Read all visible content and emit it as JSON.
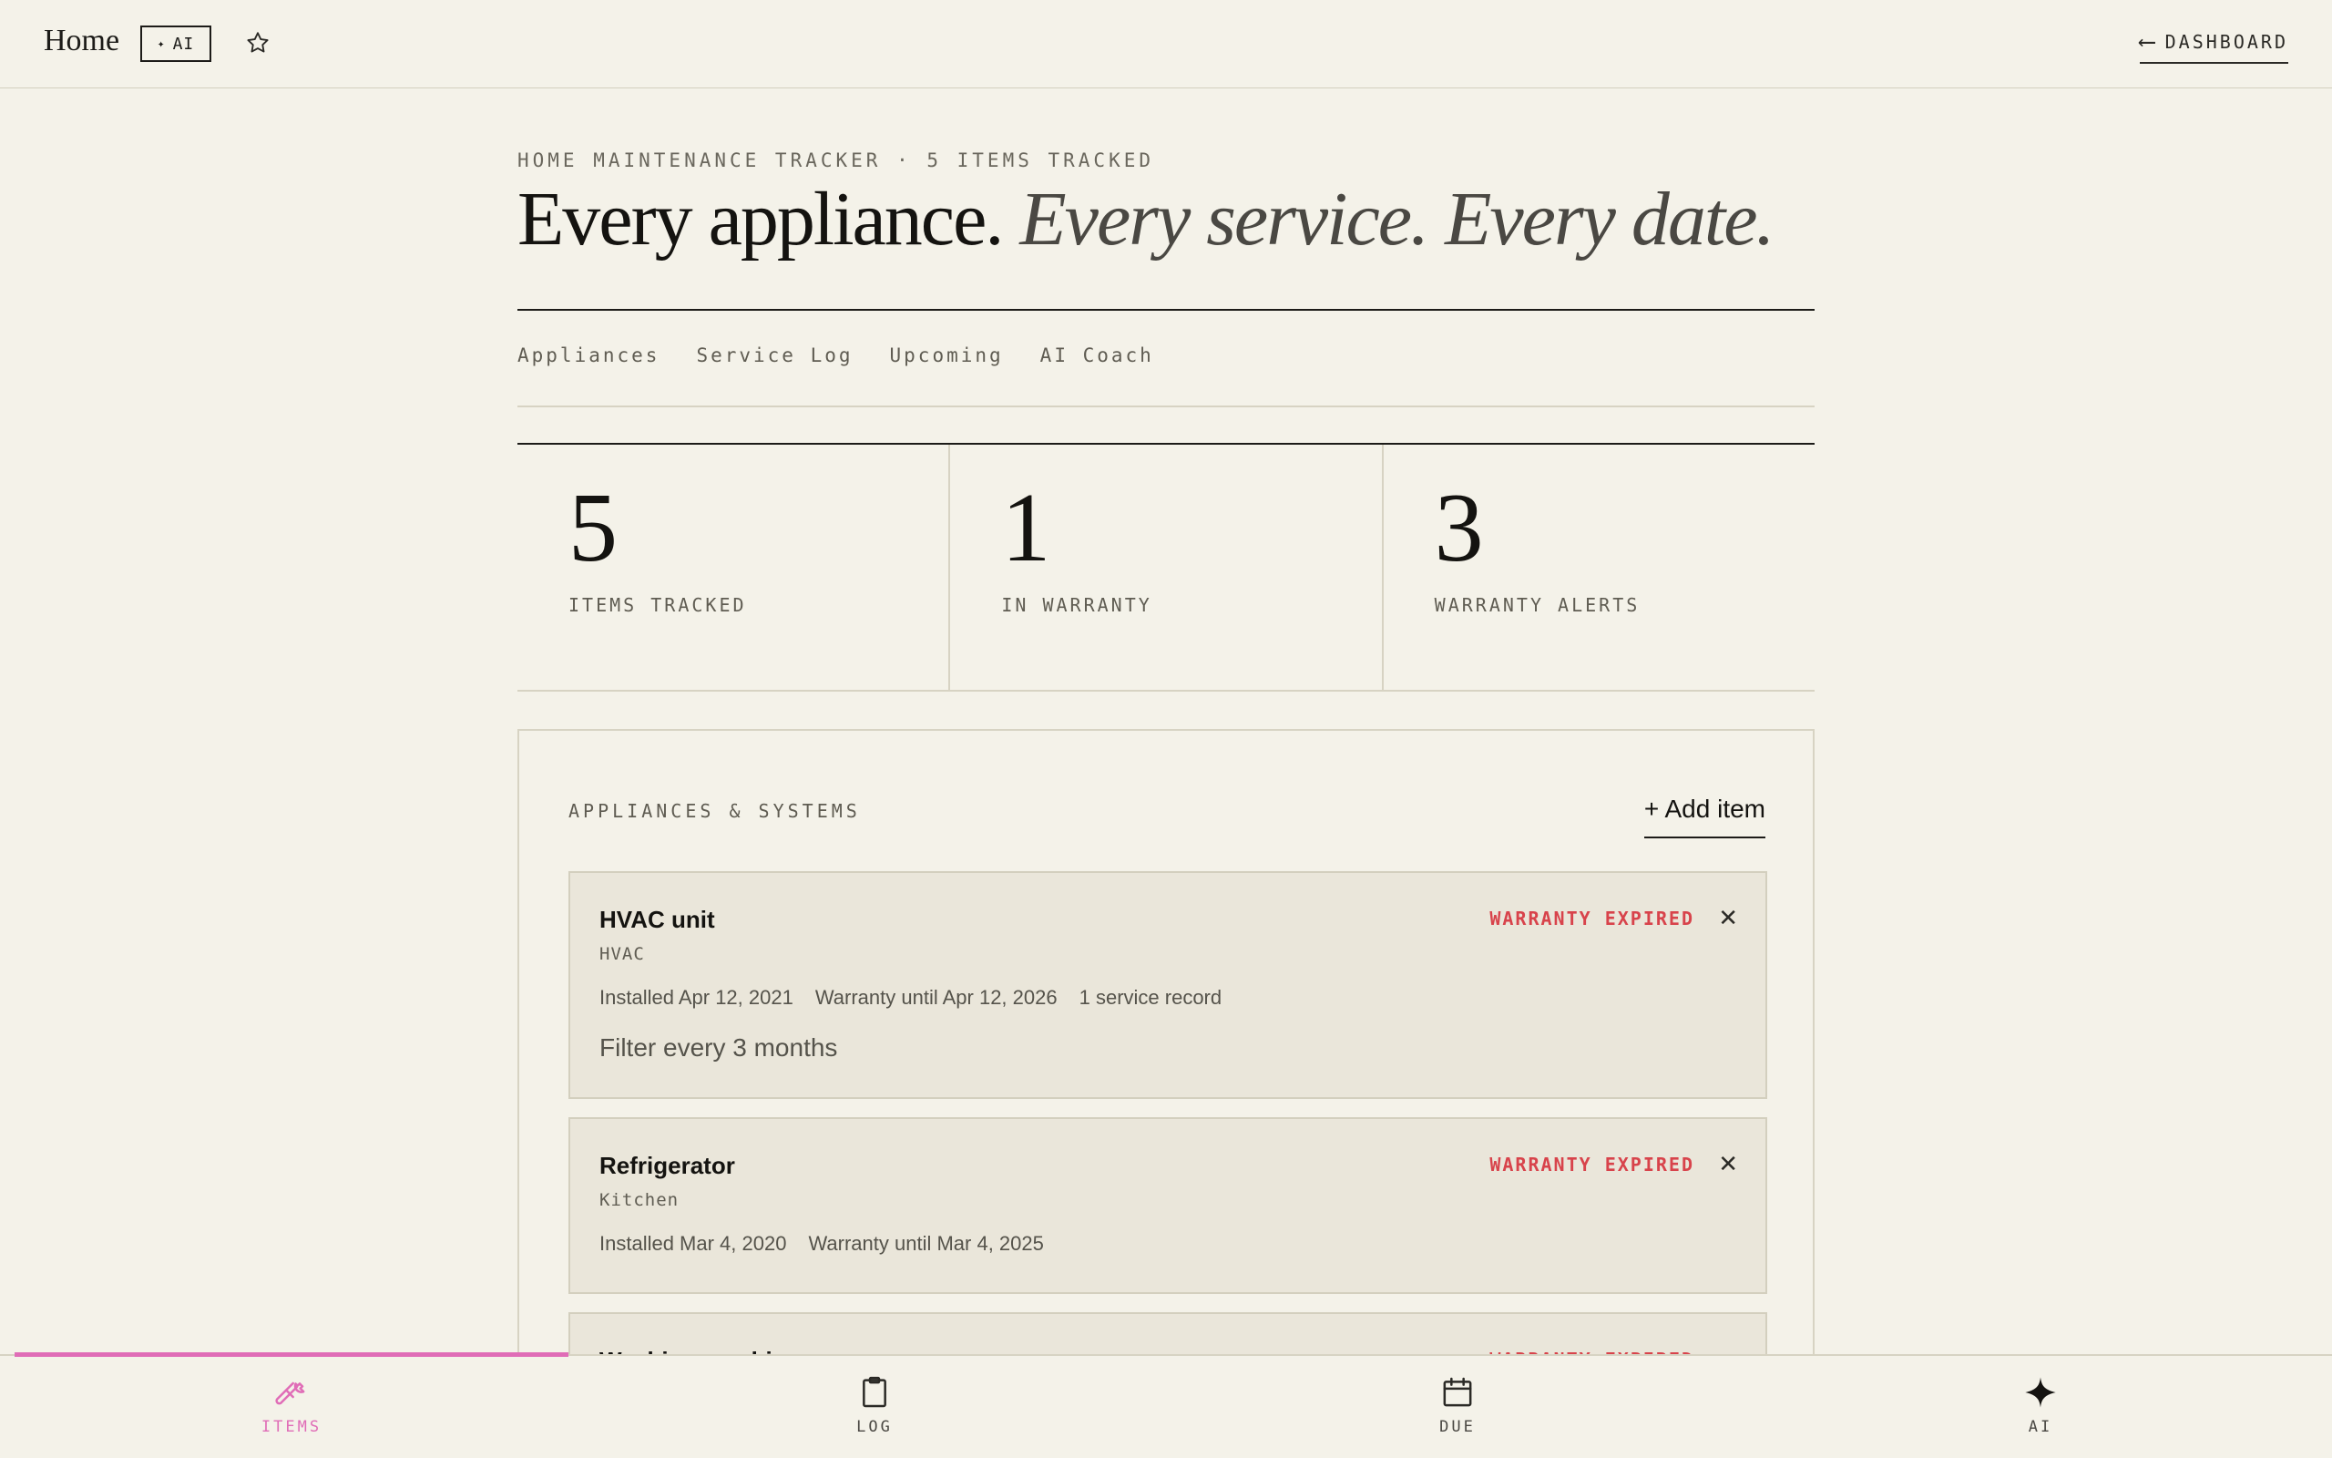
{
  "app": {
    "title": "Home",
    "ai_badge": "AI",
    "dashboard_link": "DASHBOARD"
  },
  "header": {
    "eyebrow": "HOME MAINTENANCE TRACKER · 5 ITEMS TRACKED",
    "headline_main": "Every appliance.",
    "headline_italic": "Every service. Every date."
  },
  "tabs": [
    "Appliances",
    "Service Log",
    "Upcoming",
    "AI Coach"
  ],
  "stats": [
    {
      "value": "5",
      "label": "ITEMS TRACKED"
    },
    {
      "value": "1",
      "label": "IN WARRANTY"
    },
    {
      "value": "3",
      "label": "WARRANTY ALERTS"
    }
  ],
  "panel": {
    "title": "APPLIANCES & SYSTEMS",
    "add_label": "+ Add item"
  },
  "items": [
    {
      "name": "HVAC unit",
      "category": "HVAC",
      "installed": "Installed Apr 12, 2021",
      "warranty": "Warranty until Apr 12, 2026",
      "records": "1 service record",
      "note": "Filter every 3 months",
      "status": "WARRANTY EXPIRED"
    },
    {
      "name": "Refrigerator",
      "category": "Kitchen",
      "installed": "Installed Mar 4, 2020",
      "warranty": "Warranty until Mar 4, 2025",
      "status": "WARRANTY EXPIRED"
    },
    {
      "name": "Washing machine",
      "status": "WARRANTY EXPIRED"
    }
  ],
  "bottom_nav": [
    {
      "label": "ITEMS",
      "icon": "wrench-icon",
      "active": true
    },
    {
      "label": "LOG",
      "icon": "clipboard-icon",
      "active": false
    },
    {
      "label": "DUE",
      "icon": "calendar-icon",
      "active": false
    },
    {
      "label": "AI",
      "icon": "sparkle-icon",
      "active": false
    }
  ],
  "colors": {
    "background": "#f4f2e9",
    "card": "#eae6da",
    "alert": "#d8434b",
    "accent": "#e06db7"
  }
}
